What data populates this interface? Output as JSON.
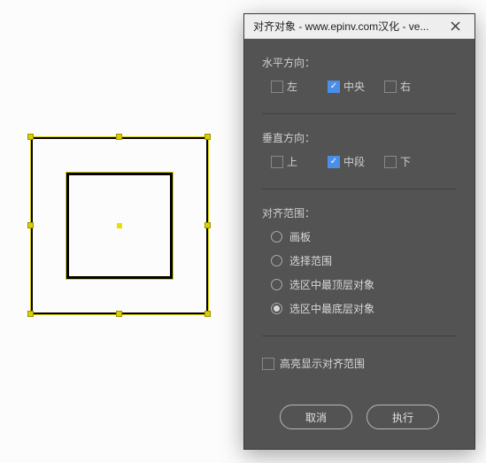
{
  "dialog": {
    "title": "对齐对象 - www.epinv.com汉化 - ve...",
    "horizontal": {
      "label": "水平方向：",
      "options": {
        "left": "左",
        "center": "中央",
        "right": "右"
      },
      "checked": "center"
    },
    "vertical": {
      "label": "垂直方向：",
      "options": {
        "top": "上",
        "middle": "中段",
        "bottom": "下"
      },
      "checked": "middle"
    },
    "scope": {
      "label": "对齐范围：",
      "options": [
        "画板",
        "选择范围",
        "选区中最顶层对象",
        "选区中最底层对象"
      ],
      "selected_index": 3
    },
    "highlight": {
      "label": "高亮显示对齐范围",
      "checked": false
    },
    "buttons": {
      "cancel": "取消",
      "execute": "执行"
    }
  }
}
